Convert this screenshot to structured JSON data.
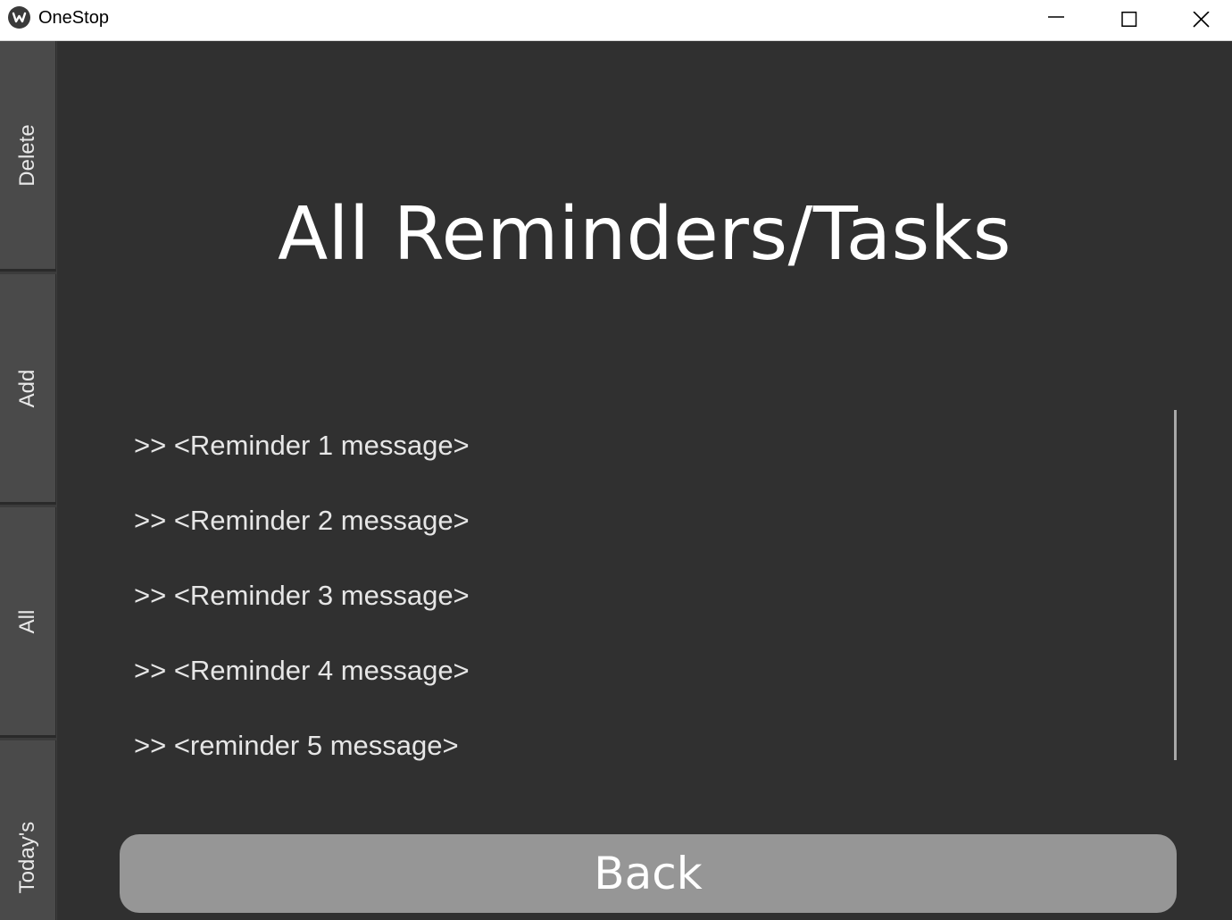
{
  "window": {
    "title": "OneStop",
    "controls": [
      "minimize",
      "maximize",
      "close"
    ]
  },
  "sidebar": {
    "items": [
      {
        "label": "Delete"
      },
      {
        "label": "Add"
      },
      {
        "label": "All"
      },
      {
        "label": "Today's"
      }
    ]
  },
  "main": {
    "title": "All Reminders/Tasks",
    "reminders": [
      ">> <Reminder 1 message>",
      ">> <Reminder 2 message>",
      ">> <Reminder 3 message>",
      ">> <Reminder 4 message>",
      ">> <reminder 5 message>"
    ],
    "back_label": "Back"
  },
  "colors": {
    "background": "#303030",
    "sidebar_button": "#4a4a4a",
    "back_button": "#969696",
    "text": "#ffffff"
  }
}
